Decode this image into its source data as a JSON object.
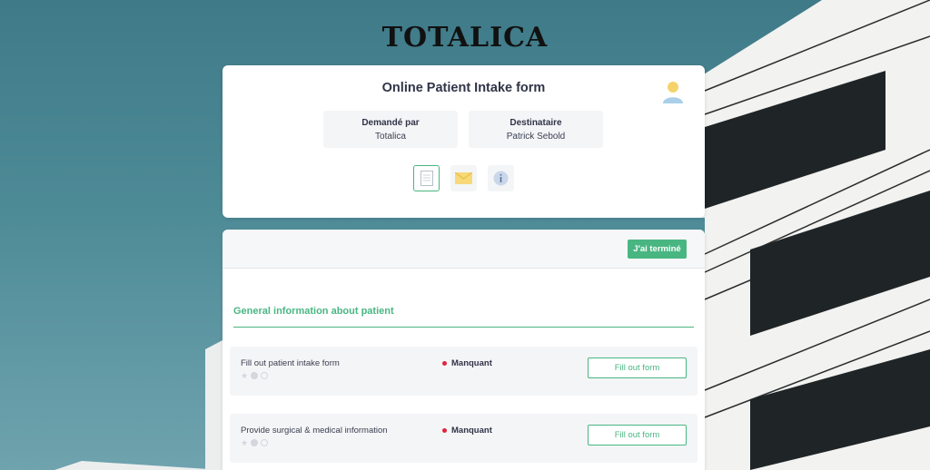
{
  "brand": {
    "logo_text": "TOTALICA"
  },
  "header": {
    "form_title": "Online Patient Intake form",
    "requested_by_label": "Demandé par",
    "requested_by_value": "Totalica",
    "recipient_label": "Destinataire",
    "recipient_value": "Patrick Sebold",
    "tabs": [
      {
        "icon": "document-icon",
        "active": true
      },
      {
        "icon": "envelope-icon",
        "active": false
      },
      {
        "icon": "info-icon",
        "active": false
      }
    ]
  },
  "toolbar": {
    "done_label": "J'ai terminé"
  },
  "section": {
    "title": "General information about patient"
  },
  "tasks": [
    {
      "label": "Fill out patient intake form",
      "status": "Manquant",
      "action": "Fill out form"
    },
    {
      "label": "Provide surgical & medical information",
      "status": "Manquant",
      "action": "Fill out form"
    }
  ],
  "colors": {
    "accent": "#49b682",
    "status_missing": "#e0243c",
    "sky": "#4d8b97"
  }
}
